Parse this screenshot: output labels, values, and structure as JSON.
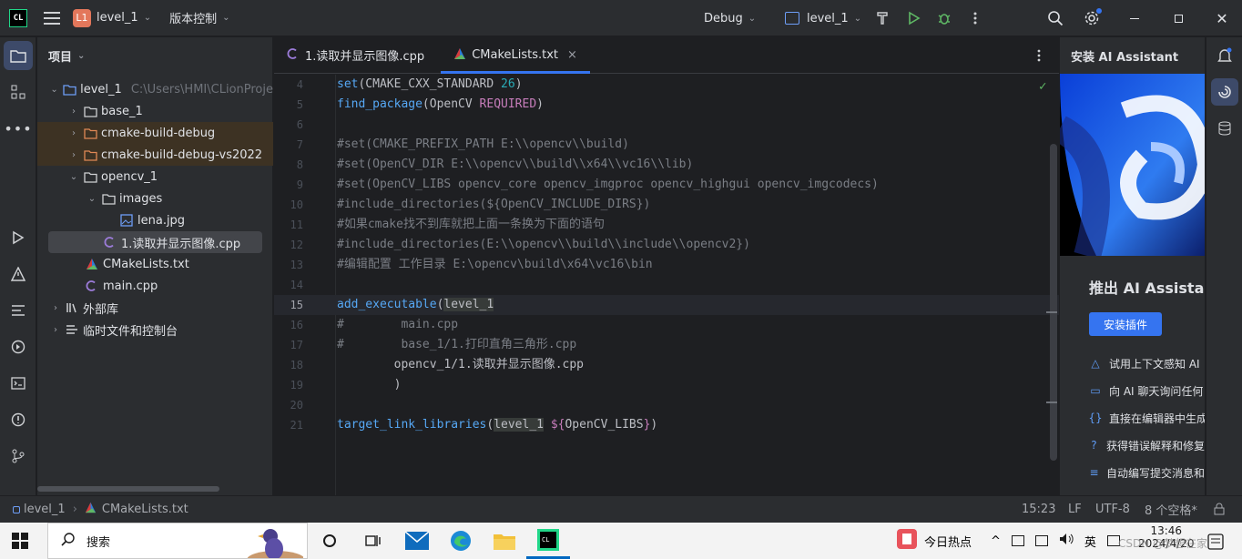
{
  "app": {
    "logo": "CL",
    "project_badge": "L1",
    "project_name": "level_1",
    "vcs_menu": "版本控制",
    "run_config": "Debug",
    "target": "level_1"
  },
  "project_panel": {
    "title": "项目",
    "tree": [
      {
        "label": "level_1",
        "hint": "C:\\Users\\HMI\\CLionProje",
        "depth": 0,
        "expanded": true,
        "icon": "folder-module-icon"
      },
      {
        "label": "base_1",
        "depth": 1,
        "expanded": false,
        "icon": "folder-icon"
      },
      {
        "label": "cmake-build-debug",
        "depth": 1,
        "expanded": false,
        "icon": "folder-excluded-icon",
        "excluded": true
      },
      {
        "label": "cmake-build-debug-vs2022",
        "depth": 1,
        "expanded": false,
        "icon": "folder-excluded-icon",
        "excluded": true
      },
      {
        "label": "opencv_1",
        "depth": 1,
        "expanded": true,
        "icon": "folder-icon"
      },
      {
        "label": "images",
        "depth": 2,
        "expanded": true,
        "icon": "folder-icon"
      },
      {
        "label": "lena.jpg",
        "depth": 3,
        "icon": "image-file-icon"
      },
      {
        "label": "1.读取并显示图像.cpp",
        "depth": 2,
        "icon": "cpp-file-icon",
        "selected": true
      },
      {
        "label": "CMakeLists.txt",
        "depth": 1,
        "icon": "cmake-file-icon"
      },
      {
        "label": "main.cpp",
        "depth": 1,
        "icon": "cpp-file-icon"
      },
      {
        "label": "外部库",
        "depth": 0,
        "expanded": false,
        "icon": "library-icon"
      },
      {
        "label": "临时文件和控制台",
        "depth": 0,
        "expanded": false,
        "icon": "scratches-icon"
      }
    ]
  },
  "editor": {
    "tabs": [
      {
        "label": "1.读取并显示图像.cpp",
        "icon": "cpp-file-icon",
        "active": false
      },
      {
        "label": "CMakeLists.txt",
        "icon": "cmake-file-icon",
        "active": true,
        "close": "×"
      }
    ],
    "current_line": "15",
    "lines": [
      {
        "n": "4"
      },
      {
        "n": "5"
      },
      {
        "n": "6"
      },
      {
        "n": "7"
      },
      {
        "n": "8"
      },
      {
        "n": "9"
      },
      {
        "n": "10"
      },
      {
        "n": "11"
      },
      {
        "n": "12"
      },
      {
        "n": "13"
      },
      {
        "n": "14"
      },
      {
        "n": "15"
      },
      {
        "n": "16"
      },
      {
        "n": "17"
      },
      {
        "n": "18"
      },
      {
        "n": "19"
      },
      {
        "n": "20"
      },
      {
        "n": "21"
      }
    ],
    "code": {
      "l4_fn": "set",
      "l4_a": "(CMAKE_CXX_STANDARD ",
      "l4_num": "26",
      "l4_b": ")",
      "l5_fn": "find_package",
      "l5_a": "(OpenCV ",
      "l5_kw": "REQUIRED",
      "l5_b": ")",
      "l7": "#set(CMAKE_PREFIX_PATH E:\\\\opencv\\\\build)",
      "l8": "#set(OpenCV_DIR E:\\\\opencv\\\\build\\\\x64\\\\vc16\\\\lib)",
      "l9": "#set(OpenCV_LIBS opencv_core opencv_imgproc opencv_highgui opencv_imgcodecs)",
      "l10": "#include_directories(${OpenCV_INCLUDE_DIRS})",
      "l11": "#如果cmake找不到库就把上面一条换为下面的语句",
      "l12": "#include_directories(E:\\\\opencv\\\\build\\\\include\\\\opencv2})",
      "l13": "#编辑配置 工作目录 E:\\opencv\\build\\x64\\vc16\\bin",
      "l15_fn": "add_executable",
      "l15_a": "(",
      "l15_hl": "level_1",
      "l16": "#        main.cpp",
      "l17": "#        base_1/1.打印直角三角形.cpp",
      "l18": "        opencv_1/1.读取并显示图像.cpp",
      "l19": "        )",
      "l21_fn": "target_link_libraries",
      "l21_a": "(",
      "l21_hl": "level_1",
      "l21_sp": " ",
      "l21_var": "${",
      "l21_b": "OpenCV_LIBS",
      "l21_var2": "}",
      "l21_c": ")"
    }
  },
  "ai_panel": {
    "title": "安装 AI Assistant",
    "heading": "推出 AI Assistant",
    "install_button": "安装插件",
    "features": [
      {
        "icon": "context-icon",
        "text": "试用上下文感知 AI"
      },
      {
        "icon": "chat-icon",
        "text": "向 AI 聊天询问任何"
      },
      {
        "icon": "code-braces-icon",
        "text": "直接在编辑器中生成"
      },
      {
        "icon": "help-icon",
        "text": "获得错误解释和修复"
      },
      {
        "icon": "commit-icon",
        "text": "自动编写提交消息和"
      }
    ]
  },
  "status_bar": {
    "breadcrumb_project": "level_1",
    "breadcrumb_file": "CMakeLists.txt",
    "position": "15:23",
    "line_sep": "LF",
    "encoding": "UTF-8",
    "indent": "8 个空格*"
  },
  "taskbar": {
    "search_placeholder": "搜索",
    "news": "今日热点",
    "ime": "英",
    "time": "13:46",
    "date": "2024/4/20",
    "watermark": "CSDN @梦想在家"
  },
  "colors": {
    "accent": "#3574f0",
    "excluded_bg": "#3d3223",
    "function": "#56a8f5",
    "keyword": "#c77dbb",
    "number": "#2aacb8",
    "comment": "#7a7e85"
  }
}
